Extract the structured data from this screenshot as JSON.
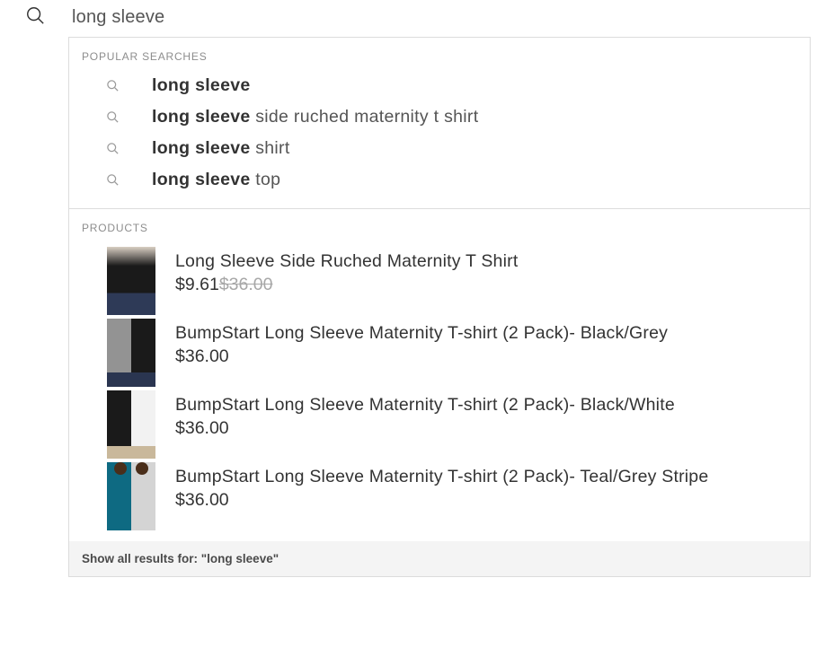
{
  "search": {
    "value": "long sleeve"
  },
  "popular_searches_header": "POPULAR SEARCHES",
  "suggestions": [
    {
      "bold": "long sleeve",
      "rest": ""
    },
    {
      "bold": "long sleeve",
      "rest": " side ruched maternity t shirt"
    },
    {
      "bold": "long sleeve",
      "rest": " shirt"
    },
    {
      "bold": "long sleeve",
      "rest": " top"
    }
  ],
  "products_header": "PRODUCTS",
  "products": [
    {
      "title": "Long Sleeve Side Ruched Maternity T Shirt",
      "price": "$9.61",
      "oldprice": "$36.00",
      "thumb_class": "thumb-a"
    },
    {
      "title": "BumpStart Long Sleeve Maternity T-shirt (2 Pack)- Black/Grey",
      "price": "$36.00",
      "oldprice": "",
      "thumb_class": "thumb-b"
    },
    {
      "title": "BumpStart Long Sleeve Maternity T-shirt (2 Pack)- Black/White",
      "price": "$36.00",
      "oldprice": "",
      "thumb_class": "thumb-c"
    },
    {
      "title": "BumpStart Long Sleeve Maternity T-shirt (2 Pack)- Teal/Grey Stripe",
      "price": "$36.00",
      "oldprice": "",
      "thumb_class": "thumb-d"
    }
  ],
  "footer": "Show all results for: \"long sleeve\""
}
